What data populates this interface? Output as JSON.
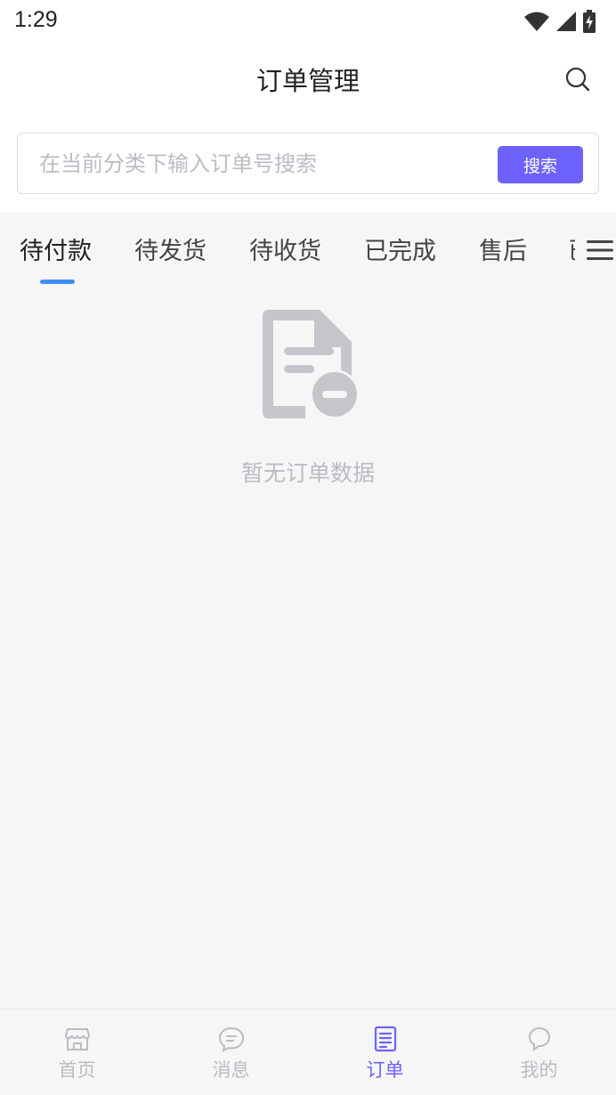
{
  "status_bar": {
    "time": "1:29",
    "icons": [
      "wifi-icon",
      "cellular-signal-icon",
      "battery-charging-icon"
    ]
  },
  "header": {
    "title": "订单管理",
    "search_icon": "search-icon"
  },
  "search": {
    "placeholder": "在当前分类下输入订单号搜索",
    "value": "",
    "button_label": "搜索",
    "button_color": "#6e62ff"
  },
  "tabs": {
    "items": [
      {
        "label": "待付款",
        "active": true
      },
      {
        "label": "待发货",
        "active": false
      },
      {
        "label": "待收货",
        "active": false
      },
      {
        "label": "已完成",
        "active": false
      },
      {
        "label": "售后",
        "active": false
      },
      {
        "label": "已",
        "active": false
      }
    ],
    "indicator_color": "#3f8ff7",
    "menu_icon": "menu-icon"
  },
  "empty_state": {
    "icon": "empty-document-icon",
    "text": "暂无订单数据"
  },
  "bottom_nav": {
    "items": [
      {
        "label": "首页",
        "icon": "store-icon",
        "active": false
      },
      {
        "label": "消息",
        "icon": "message-icon",
        "active": false
      },
      {
        "label": "订单",
        "icon": "order-icon",
        "active": true
      },
      {
        "label": "我的",
        "icon": "profile-icon",
        "active": false
      }
    ],
    "active_color": "#6e62ff",
    "inactive_color": "#b9bcc4"
  }
}
